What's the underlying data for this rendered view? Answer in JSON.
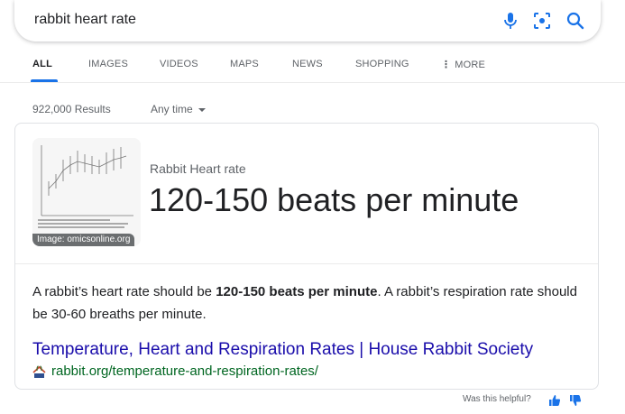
{
  "search": {
    "query": "rabbit heart rate"
  },
  "tabs": [
    {
      "label": "ALL",
      "active": true
    },
    {
      "label": "IMAGES"
    },
    {
      "label": "VIDEOS"
    },
    {
      "label": "MAPS"
    },
    {
      "label": "NEWS"
    },
    {
      "label": "SHOPPING"
    },
    {
      "label": "MORE"
    }
  ],
  "results_count": "922,000 Results",
  "time_filter": "Any time",
  "featured": {
    "image_caption": "Image: omicsonline.org",
    "label": "Rabbit Heart rate",
    "value": "120-150 beats per minute",
    "snippet_before": "A rabbit’s heart rate should be ",
    "snippet_bold": "120-150 beats per minute",
    "snippet_after": ". A rabbit’s respiration rate should be 30-60 breaths per minute.",
    "result_title": "Temperature, Heart and Respiration Rates | House Rabbit Society",
    "result_url": "rabbit.org/temperature-and-respiration-rates/"
  },
  "feedback": {
    "prompt": "Was this helpful?"
  },
  "colors": {
    "accent": "#1a73e8",
    "link": "#1a0dab",
    "url": "#006621",
    "text": "#202124",
    "muted": "#5f6368"
  }
}
